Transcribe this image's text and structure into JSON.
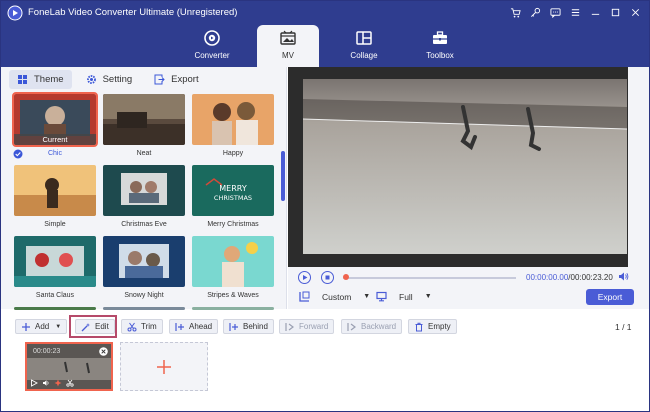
{
  "app": {
    "title": "FoneLab Video Converter Ultimate (Unregistered)"
  },
  "nav": {
    "tabs": [
      {
        "label": "Converter",
        "icon": "converter-icon"
      },
      {
        "label": "MV",
        "icon": "mv-icon",
        "active": true
      },
      {
        "label": "Collage",
        "icon": "collage-icon"
      },
      {
        "label": "Toolbox",
        "icon": "toolbox-icon"
      }
    ]
  },
  "subtabs": {
    "theme": "Theme",
    "setting": "Setting",
    "export": "Export"
  },
  "themes": [
    {
      "label": "Chic",
      "current": true
    },
    {
      "label": "Neat"
    },
    {
      "label": "Happy"
    },
    {
      "label": "Simple"
    },
    {
      "label": "Christmas Eve"
    },
    {
      "label": "Merry Christmas"
    },
    {
      "label": "Santa Claus"
    },
    {
      "label": "Snowy Night"
    },
    {
      "label": "Stripes & Waves"
    }
  ],
  "current_tag": "Current",
  "merry_text": "MERRY\nCHRISTMAS",
  "player": {
    "current_time": "00:00:00.00",
    "separator": "/",
    "total_time": "00:00:23.20",
    "progress": 0.0,
    "aspect": "Custom",
    "mode": "Full",
    "export_label": "Export"
  },
  "toolbar": {
    "add": "Add",
    "edit": "Edit",
    "trim": "Trim",
    "ahead": "Ahead",
    "behind": "Behind",
    "forward": "Forward",
    "backward": "Backward",
    "empty": "Empty"
  },
  "pager": "1 / 1",
  "clip": {
    "duration": "00:00:23"
  },
  "colors": {
    "accent": "#4a5cd6",
    "header": "#2f3d8f",
    "highlight": "#f0644e"
  }
}
